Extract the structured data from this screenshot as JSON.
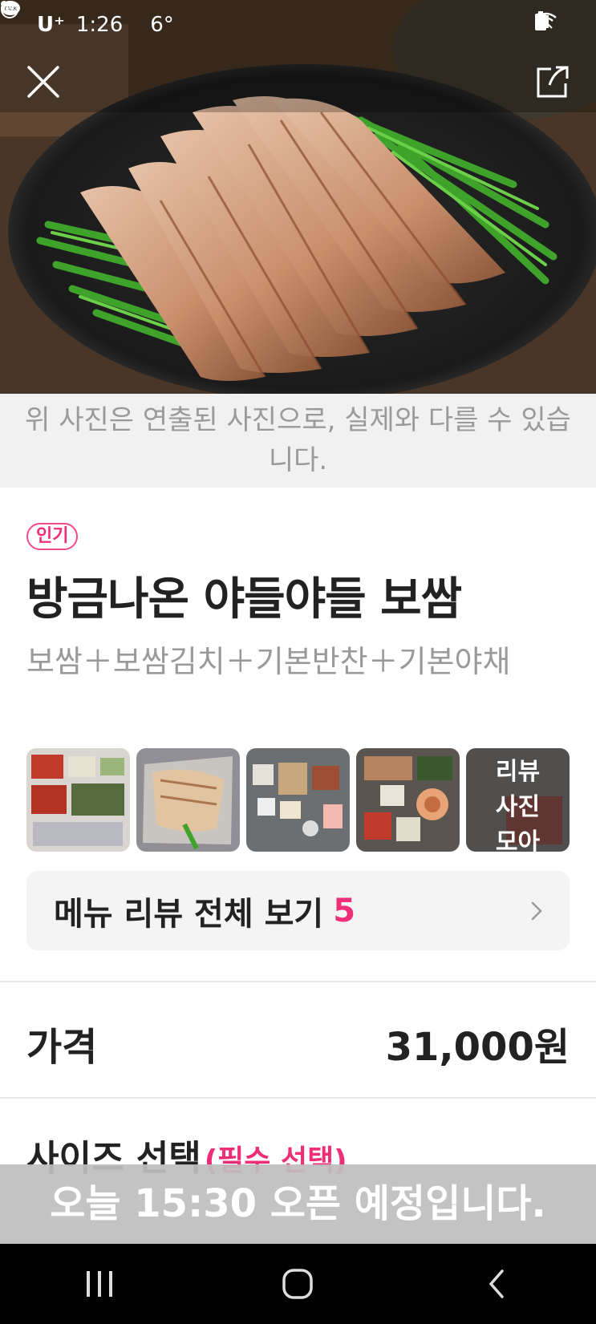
{
  "status_bar": {
    "carrier": "U⁺",
    "time": "1:26",
    "temperature": "6°",
    "icons": [
      "kakaotalk-icon",
      "b-app-icon",
      "dot-icon",
      "mute-icon",
      "wifi-icon",
      "signal-icon",
      "battery-icon"
    ]
  },
  "header": {
    "close_icon": "close-icon",
    "share_icon": "share-icon"
  },
  "disclaimer": "위 사진은 연출된 사진으로, 실제와 다를 수 있습니다.",
  "menu": {
    "badge": "인기",
    "title": "방금나온 야들야들 보쌈",
    "description": "보쌈＋보쌈김치＋기본반찬＋기본야채"
  },
  "review_photos": {
    "more_label": "리뷰 사진 모아보기"
  },
  "reviews": {
    "label": "메뉴 리뷰 전체 보기",
    "count": "5"
  },
  "price": {
    "label": "가격",
    "value": "31,000원"
  },
  "size": {
    "label": "사이즈 선택",
    "required": "(필수 선택)"
  },
  "toast": "오늘 15:30 오픈 예정입니다.",
  "colors": {
    "accent": "#ef2e78",
    "muted_text": "#9a9a9a",
    "disclaimer_bg": "#f1f1f1",
    "button_bg": "#f4f4f4"
  }
}
